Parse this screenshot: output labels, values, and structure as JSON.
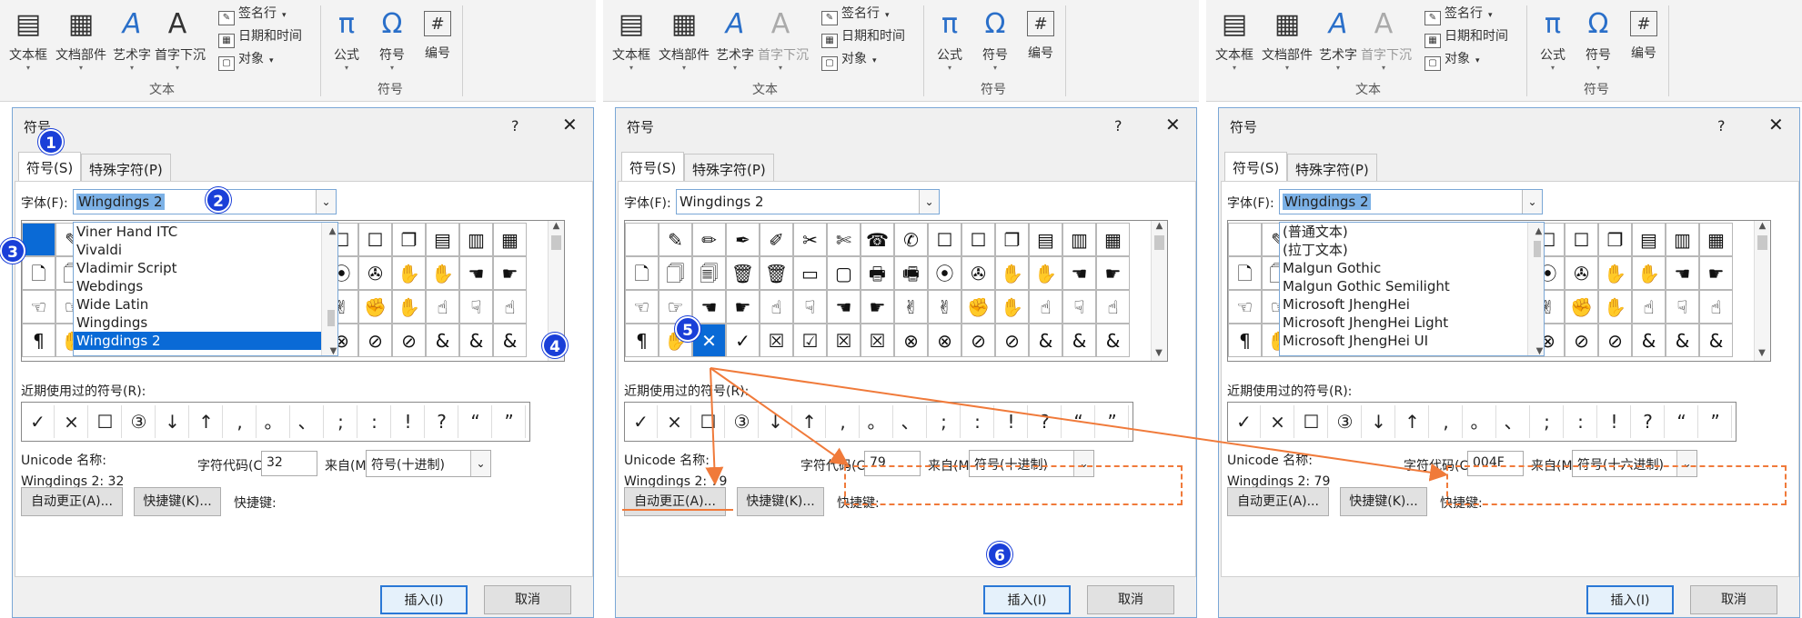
{
  "ribbon": {
    "buttons": [
      "文本框",
      "文档部件",
      "艺术字",
      "首字下沉"
    ],
    "small_items": [
      "签名行",
      "日期和时间",
      "对象"
    ],
    "group_text": "文本",
    "symbol_buttons": [
      "公式",
      "符号",
      "编号"
    ],
    "group_symbol": "符号",
    "icons": [
      "textbox-icon",
      "doc-parts-icon",
      "wordart-icon",
      "dropcap-icon",
      "pi-icon",
      "omega-icon",
      "number-icon"
    ]
  },
  "dialog": {
    "title": "符号",
    "help": "?",
    "close": "✕",
    "tabs": [
      "符号(S)",
      "特殊字符(P)"
    ],
    "font_label": "字体(F):",
    "font_value": "Wingdings 2",
    "recent_label": "近期使用过的符号(R):",
    "recent_symbols": [
      "✓",
      "×",
      "☐",
      "③",
      "↓",
      "↑",
      ",",
      "。",
      "、",
      ";",
      ":",
      "!",
      "?",
      "“",
      "”"
    ],
    "unicode_label": "Unicode 名称:",
    "char_code_label": "字符代码(C):",
    "from_label": "来自(M):",
    "autocorrect": "自动更正(A)...",
    "shortcut_key_btn": "快捷键(K)...",
    "shortcut_label": "快捷键:",
    "insert": "插入(I)",
    "cancel": "取消"
  },
  "grid": {
    "rows": [
      [
        "",
        "✎",
        "✏",
        "✒",
        "✐",
        "✂",
        "✄",
        "☎",
        "✆",
        "☐",
        "☐",
        "❐",
        "▤",
        "▥",
        "▦"
      ],
      [
        "🗋",
        "🗍",
        "🗐",
        "🗑",
        "🗑",
        "▭",
        "▢",
        "🖶",
        "🖷",
        "⦿",
        "✇",
        "✋",
        "✋",
        "☚",
        "☛"
      ],
      [
        "☜",
        "☞",
        "☚",
        "☛",
        "☝",
        "☟",
        "☚",
        "☛",
        "✌",
        "✌",
        "✊",
        "✋",
        "☝",
        "☟",
        "☝"
      ],
      [
        "¶",
        "✋",
        "✕",
        "✓",
        "☒",
        "☑",
        "☒",
        "☒",
        "⊗",
        "⊗",
        "⊘",
        "⊘",
        "&",
        "&",
        "&"
      ]
    ]
  },
  "panels": [
    {
      "unicode_value": "Wingdings 2: 32",
      "char_code": "32",
      "from_value": "符号(十进制)",
      "selected_cell": "0,0",
      "font_list": [
        "Viner Hand ITC",
        "Vivaldi",
        "Vladimir Script",
        "Webdings",
        "Wide Latin",
        "Wingdings",
        "Wingdings 2"
      ],
      "font_list_selected": "Wingdings 2",
      "markers": [
        "1",
        "2",
        "3",
        "4"
      ]
    },
    {
      "unicode_value": "Wingdings 2: 79",
      "char_code": "79",
      "from_value": "符号(十进制)",
      "selected_cell": "3,2",
      "markers": [
        "5",
        "6"
      ]
    },
    {
      "unicode_value": "Wingdings 2: 79",
      "char_code": "004F",
      "from_value": "符号(十六进制)",
      "selected_cell": "3,2",
      "font_list": [
        "(普通文本)",
        "(拉丁文本)",
        "Malgun Gothic",
        "Malgun Gothic Semilight",
        "Microsoft JhengHei",
        "Microsoft JhengHei Light",
        "Microsoft JhengHei UI"
      ],
      "font_list_selected": ""
    }
  ],
  "colors": {
    "marker": "#1a3fd8",
    "annotation": "#f07a3a",
    "selection": "#0a6ad6"
  }
}
